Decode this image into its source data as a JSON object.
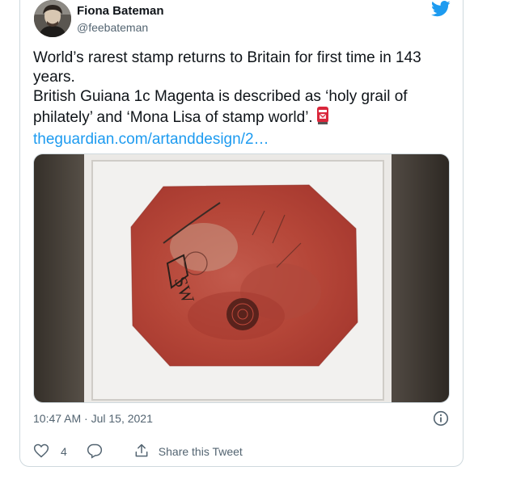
{
  "author": {
    "name": "Fiona Bateman",
    "handle": "@feebateman"
  },
  "tweet": {
    "line1": "World’s rarest stamp returns to Britain for first time in 143",
    "line2": "years.",
    "line3": "British Guiana 1c Magenta is described as ‘holy grail of",
    "line4": "philately’ and ‘Mona Lisa of stamp world’.",
    "link": "theguardian.com/artanddesign/2…"
  },
  "timestamp": "10:47 AM · Jul 15, 2021",
  "actions": {
    "like_count": "4",
    "share_label": "Share this Tweet"
  },
  "icons": {
    "bird": "twitter-bird-icon",
    "info": "info-icon",
    "like": "heart-icon",
    "reply": "reply-bubble-icon",
    "share": "share-upload-icon",
    "emoji": "postbox-emoji-icon"
  },
  "colors": {
    "link": "#1d9bf0",
    "secondary_text": "#536471",
    "border": "#cfd9de",
    "stamp": "#b8453a"
  }
}
